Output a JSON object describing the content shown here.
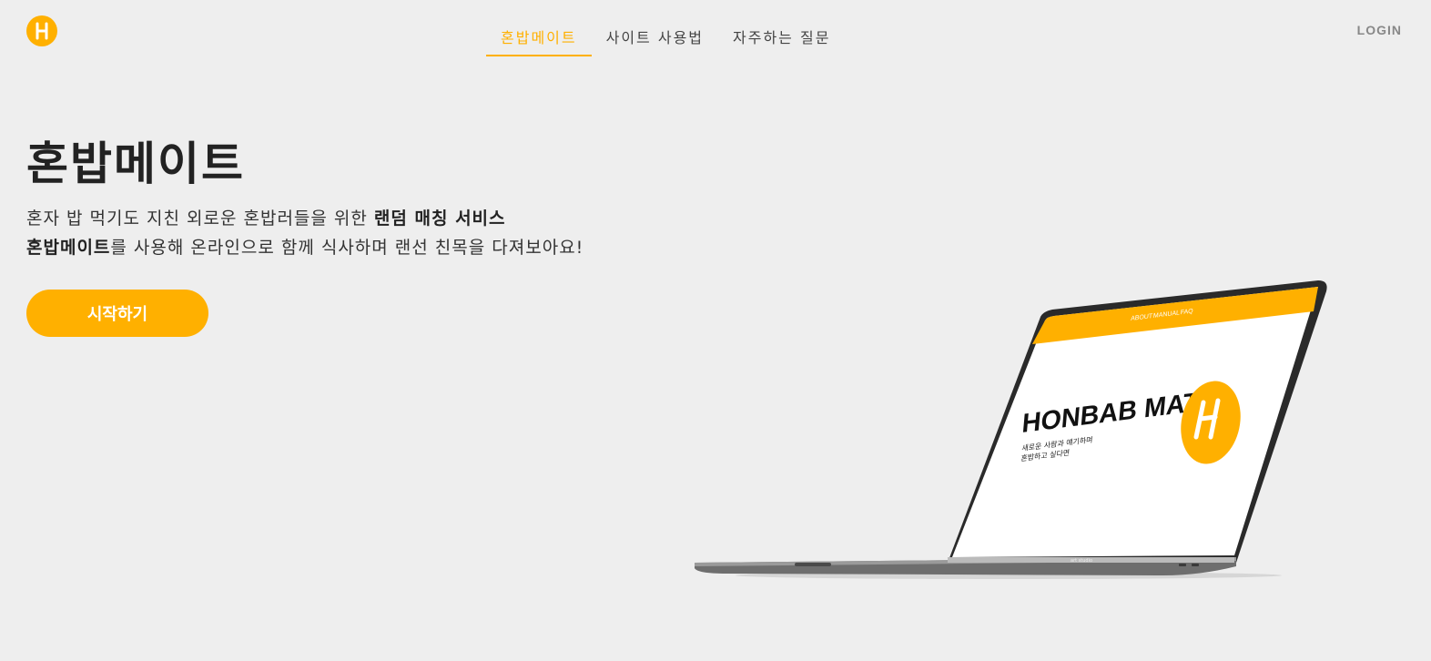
{
  "header": {
    "logo_letter": "H",
    "nav": [
      {
        "label": "혼밥메이트",
        "active": true
      },
      {
        "label": "사이트 사용법",
        "active": false
      },
      {
        "label": "자주하는 질문",
        "active": false
      }
    ],
    "login_label": "LOGIN"
  },
  "hero": {
    "title": "혼밥메이트",
    "desc_line1_plain": "혼자 밥 먹기도 지친 외로운 혼밥러들을 위한 ",
    "desc_line1_bold": "랜덤 매칭 서비스",
    "desc_line2_bold": "혼밥메이트",
    "desc_line2_plain": "를 사용해 온라인으로 함께 식사하며 랜선 친목을 다져보아요!",
    "start_label": "시작하기"
  },
  "laptop_screen": {
    "nav": [
      "ABOUT",
      "MANUAL",
      "FAQ"
    ],
    "title": "HONBAB MATE",
    "subtitle_line1": "새로운 사람과 얘기하며",
    "subtitle_line2": "혼밥하고 싶다면",
    "logo_letter": "H",
    "brand": "art studio"
  },
  "colors": {
    "accent": "#ffb000",
    "background": "#eeeeee",
    "text": "#222222"
  }
}
